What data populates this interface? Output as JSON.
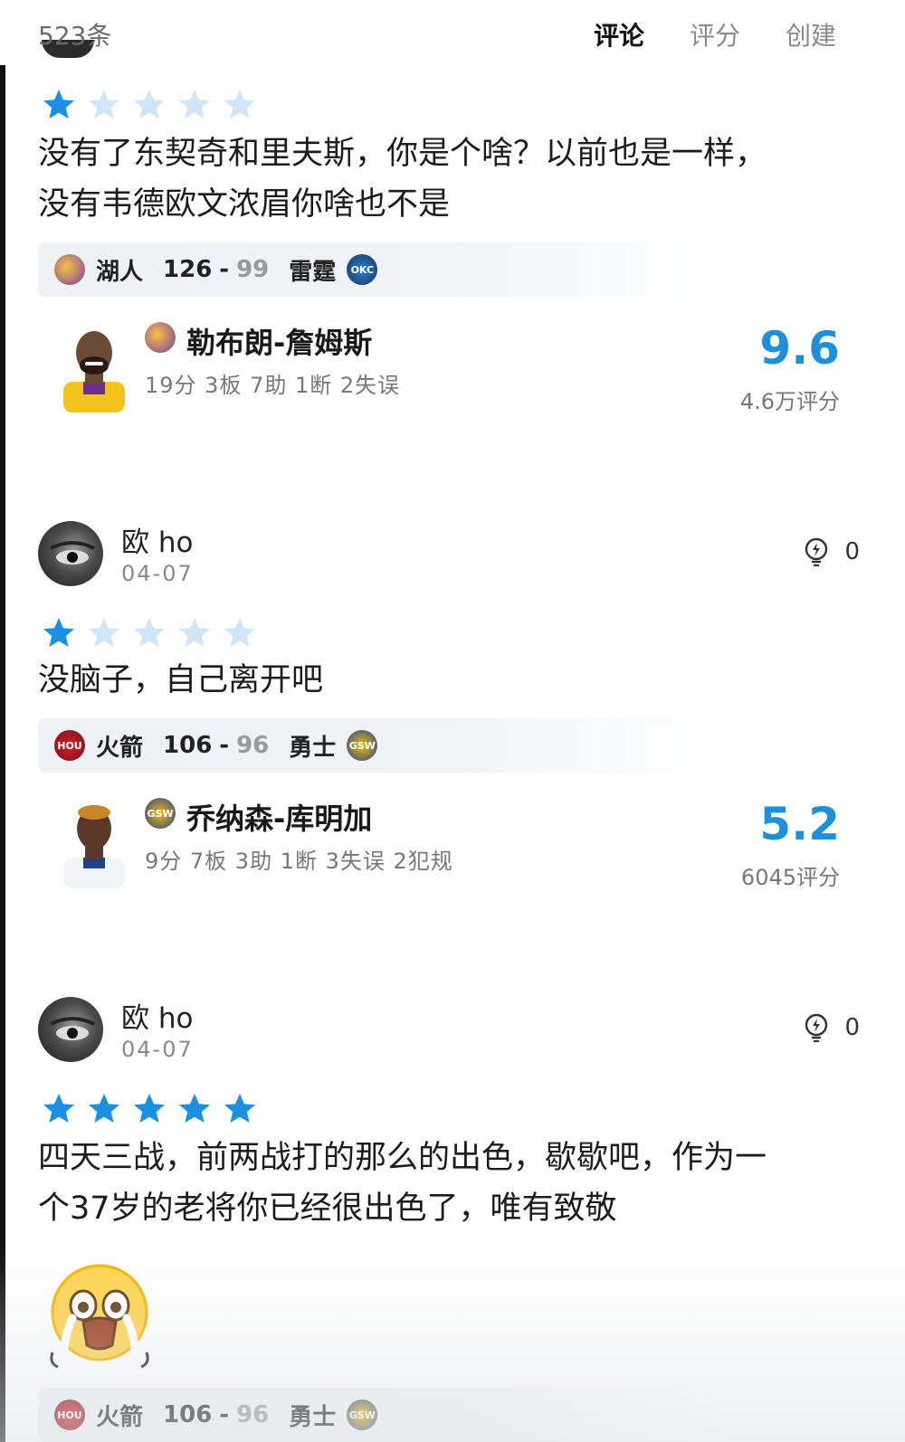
{
  "header": {
    "count": "523条",
    "tabs": [
      "评论",
      "评分",
      "创建"
    ],
    "active_tab": "评论"
  },
  "colors": {
    "star_filled": "#1a8fe3",
    "star_empty": "#cfe6f8",
    "rating_blue": "#1f8fd9"
  },
  "comments": [
    {
      "rating_stars": 1,
      "text_lines": [
        "没有了东契奇和里夫斯，你是个啥？以前也是一样，",
        "没有韦德欧文浓眉你啥也不是"
      ],
      "game": {
        "home_team": "湖人",
        "home_score": "126",
        "away_score": "99",
        "away_team": "雷霆",
        "home_logo": "lakers-logo-icon",
        "away_logo": "okc-logo-icon"
      },
      "player": {
        "name": "勒布朗-詹姆斯",
        "stats": "19分 3板 7助 1断 2失误",
        "score": "9.6",
        "count": "4.6万评分",
        "team_logo": "lakers-logo-icon"
      }
    },
    {
      "user": "欧 ho",
      "date": "04-07",
      "likes": "0",
      "rating_stars": 1,
      "text_lines": [
        "没脑子，自己离开吧"
      ],
      "game": {
        "home_team": "火箭",
        "home_score": "106",
        "away_score": "96",
        "away_team": "勇士",
        "home_logo": "rockets-logo-icon",
        "away_logo": "gsw-logo-icon"
      },
      "player": {
        "name": "乔纳森-库明加",
        "stats": "9分 7板 3助 1断 3失误 2犯规",
        "score": "5.2",
        "count": "6045评分",
        "team_logo": "gsw-logo-icon"
      }
    },
    {
      "user": "欧 ho",
      "date": "04-07",
      "likes": "0",
      "rating_stars": 5,
      "text_lines": [
        "四天三战，前两战打的那么的出色，歇歇吧，作为一",
        "个37岁的老将你已经很出色了，唯有致敬"
      ],
      "emoji": "crying-emoji",
      "game": {
        "home_team": "火箭",
        "home_score": "106",
        "away_score": "96",
        "away_team": "勇士"
      }
    }
  ],
  "logo_texts": {
    "okc": "OKC",
    "hou": "HOU",
    "gsw": "GSW"
  }
}
